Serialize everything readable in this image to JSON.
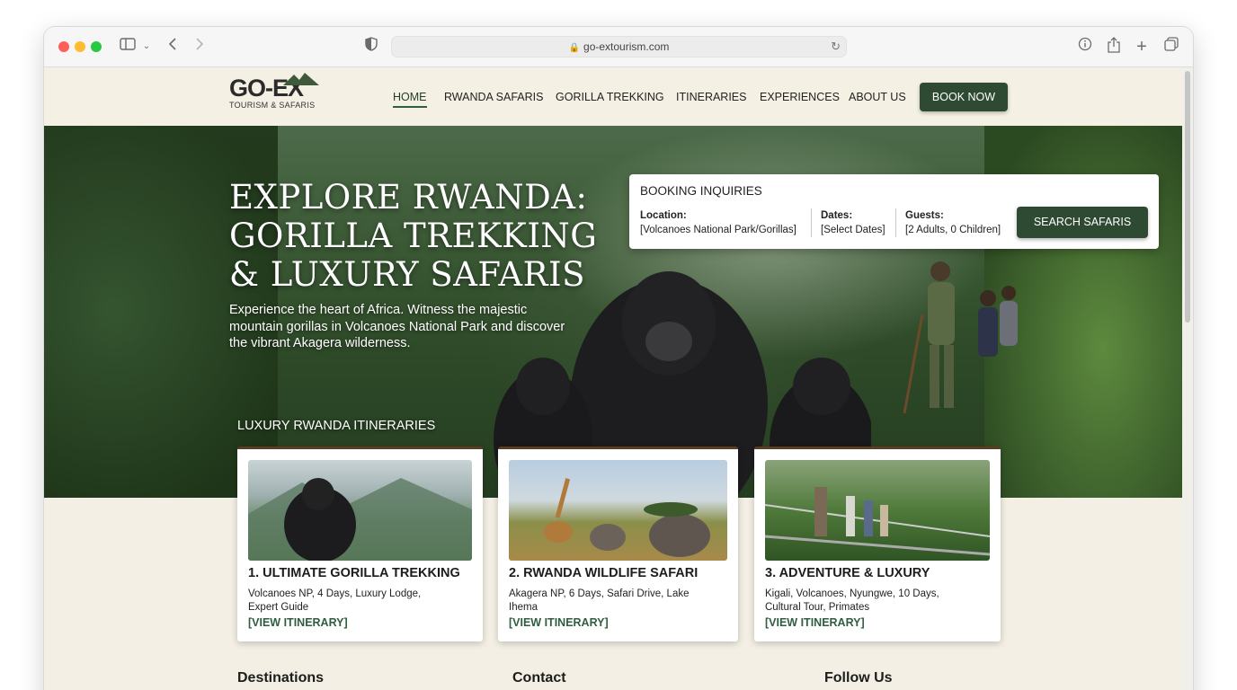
{
  "browser": {
    "url": "go-extourism.com"
  },
  "site": {
    "logo_main": "GO-EX",
    "logo_sub": "TOURISM & SAFARIS",
    "nav": [
      "HOME",
      "RWANDA SAFARIS",
      "GORILLA TREKKING",
      "ITINERARIES",
      "EXPERIENCES",
      "ABOUT US"
    ],
    "book_now": "BOOK NOW",
    "accent": "#2e4a33"
  },
  "hero": {
    "title_line1": "EXPLORE RWANDA:",
    "title_line2": "GORILLA TREKKING",
    "title_line3": "& LUXURY SAFARIS",
    "text": "Experience the heart of Africa. Witness the majestic mountain gorillas in Volcanoes National Park and discover the vibrant Akagera wilderness.",
    "itineraries_heading": "LUXURY RWANDA ITINERARIES"
  },
  "booking": {
    "title": "BOOKING INQUIRIES",
    "location_label": "Location:",
    "location_value": "[Volcanoes National Park/Gorillas]",
    "dates_label": "Dates:",
    "dates_value": "[Select Dates]",
    "guests_label": "Guests:",
    "guests_value": "[2 Adults, 0 Children]",
    "search_button": "SEARCH SAFARIS"
  },
  "cards": [
    {
      "title": "1. ULTIMATE GORILLA TREKKING",
      "desc": "Volcanoes NP, 4 Days, Luxury Lodge, Expert Guide",
      "link": "[VIEW ITINERARY]"
    },
    {
      "title": "2. RWANDA WILDLIFE SAFARI",
      "desc": "Akagera NP, 6 Days, Safari Drive, Lake Ihema",
      "link": "[VIEW ITINERARY]"
    },
    {
      "title": "3. ADVENTURE & LUXURY",
      "desc": "Kigali, Volcanoes, Nyungwe, 10 Days, Cultural Tour, Primates",
      "link": "[VIEW ITINERARY]"
    }
  ],
  "footer": {
    "destinations": "Destinations",
    "contact": "Contact",
    "follow": "Follow Us"
  }
}
